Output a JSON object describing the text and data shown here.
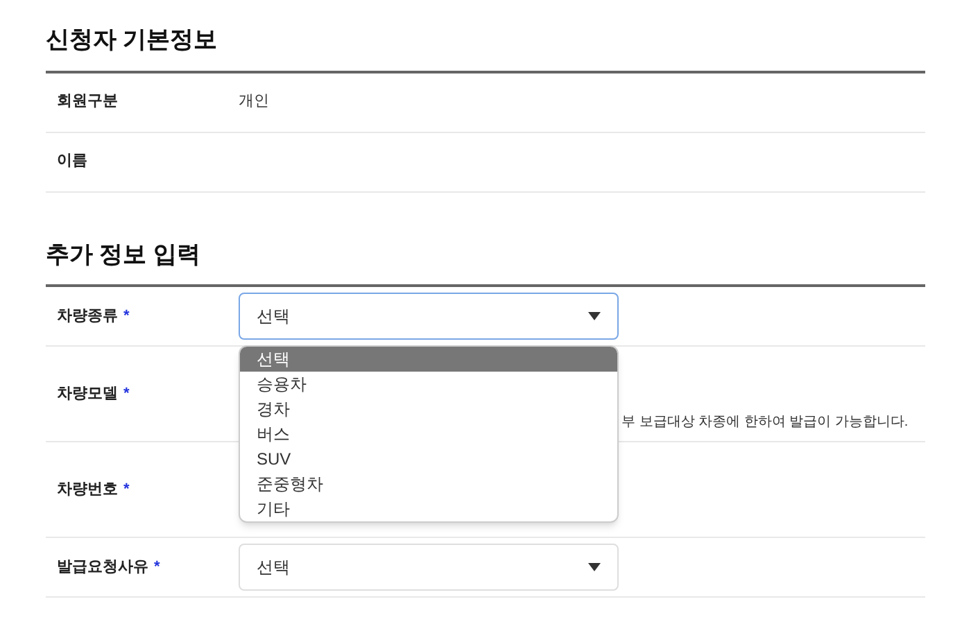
{
  "sections": [
    {
      "title": "신청자 기본정보",
      "rows": [
        {
          "kind": "text",
          "label": "회원구분",
          "value": "개인"
        },
        {
          "kind": "text",
          "label": "이름"
        }
      ]
    },
    {
      "title": "추가 정보 입력",
      "rows": [
        {
          "kind": "select",
          "label": "차량종류",
          "required_mark": "*",
          "value": "선택",
          "focused": true,
          "options": [
            {
              "label": "선택",
              "selected": true
            },
            {
              "label": "승용차",
              "selected": false
            },
            {
              "label": "경차",
              "selected": false
            },
            {
              "label": "버스",
              "selected": false
            },
            {
              "label": "SUV",
              "selected": false
            },
            {
              "label": "준중형차",
              "selected": false
            },
            {
              "label": "기타",
              "selected": false
            }
          ]
        },
        {
          "kind": "note",
          "label": "차량모델",
          "required_mark": "*",
          "note": "부 보급대상 차종에 한하여 발급이 가능합니다."
        },
        {
          "kind": "blank",
          "label": "차량번호",
          "required_mark": "*"
        },
        {
          "kind": "select",
          "label": "발급요청사유",
          "required_mark": "*",
          "value": "선택",
          "focused": false
        }
      ]
    }
  ]
}
